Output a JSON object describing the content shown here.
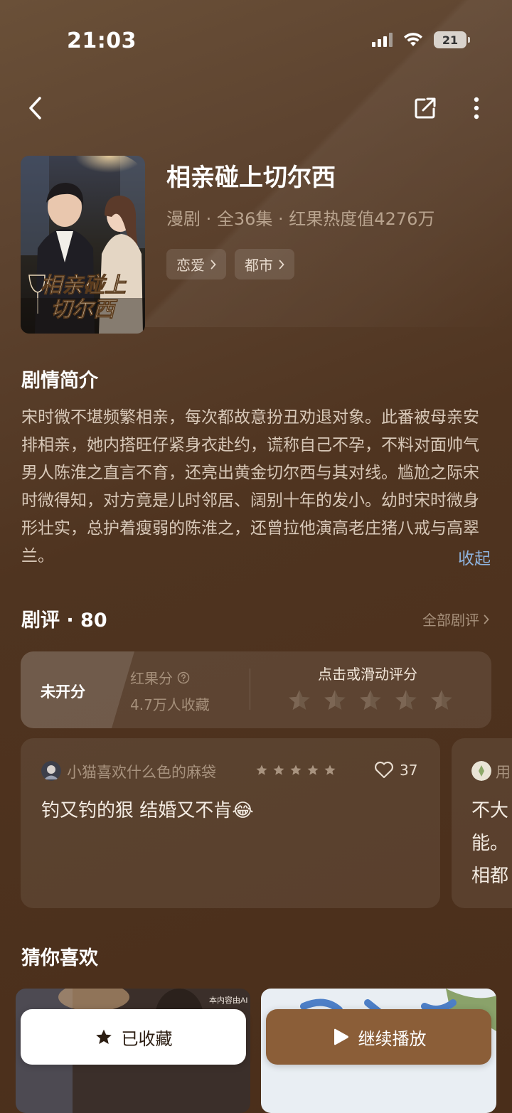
{
  "status_bar": {
    "time": "21:03",
    "battery": "21"
  },
  "nav": {
    "back_icon": "chevron-left-icon",
    "share_icon": "share-icon",
    "more_icon": "more-vertical-icon"
  },
  "drama": {
    "poster_title_line1": "相亲碰上",
    "poster_title_line2": "切尔西",
    "title": "相亲碰上切尔西",
    "meta": "漫剧 · 全36集 · 红果热度值4276万",
    "tags": [
      "恋爱",
      "都市"
    ]
  },
  "synopsis": {
    "heading": "剧情简介",
    "text": "宋时微不堪频繁相亲，每次都故意扮丑劝退对象。此番被母亲安排相亲，她内搭旺仔紧身衣赴约，谎称自己不孕，不料对面帅气男人陈淮之直言不育，还亮出黄金切尔西与其对线。尴尬之际宋时微得知，对方竟是儿时邻居、阔别十年的发小。幼时宋时微身形壮实，总护着瘦弱的陈淮之，还曾拉他演高老庄猪八戒与高翠兰。",
    "collapse_label": "收起"
  },
  "reviews": {
    "heading": "剧评 · 80",
    "all_label": "全部剧评",
    "rating": {
      "score_text": "未开分",
      "score_label": "红果分",
      "collect_count": "4.7万人收藏",
      "rate_prompt": "点击或滑动评分"
    },
    "items": [
      {
        "user": "小猫喜欢什么色的麻袋",
        "rating": 5,
        "likes": "37",
        "text": "钓又钓的狠 结婚又不肯😂"
      },
      {
        "user": "用",
        "text_lines": [
          "不大",
          "能。",
          "相都"
        ]
      }
    ]
  },
  "recommendations": {
    "heading": "猜你喜欢",
    "first_watermark": "本内容由AI"
  },
  "actions": {
    "collect_label": "已收藏",
    "play_label": "继续播放"
  },
  "colors": {
    "accent_link": "#8eb3de",
    "play_button": "#8b5e38"
  }
}
